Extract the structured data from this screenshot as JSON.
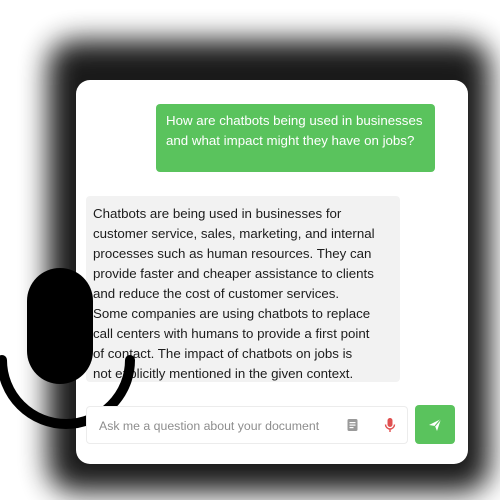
{
  "chat": {
    "user_message": "How are chatbots being used in businesses and what impact might they have on jobs?",
    "bot_message_lines": [
      "Chatbots are being used in businesses for",
      "customer service, sales, marketing, and internal",
      "processes such as human resources. They can",
      "provide faster and cheaper assistance to clients",
      "and reduce the cost of customer services.",
      "Some companies are using chatbots to replace",
      "call centers with humans to provide a first point",
      "of contact. The impact of chatbots on jobs is",
      "not explicitly mentioned in the given context."
    ]
  },
  "composer": {
    "placeholder": "Ask me a question about your document",
    "value": ""
  },
  "icons": {
    "document": "document-icon",
    "microphone": "microphone-icon",
    "send": "send-icon"
  },
  "colors": {
    "accent_green": "#5ac35d",
    "bot_bubble_bg": "#f2f2f2",
    "mic_red": "#e05050",
    "halo_dark": "#0e0e0e"
  }
}
